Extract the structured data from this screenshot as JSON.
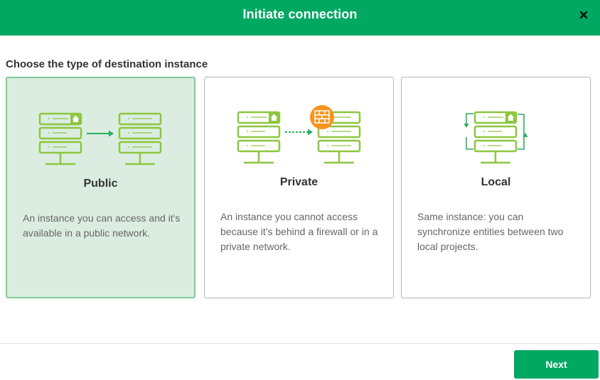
{
  "dialog": {
    "title": "Initiate connection",
    "close_icon": "close-icon"
  },
  "main": {
    "subtitle": "Choose the type of destination instance",
    "options": [
      {
        "title": "Public",
        "description": "An instance you can access and it's available in a public network.",
        "selected": true,
        "icon": "public-instance-icon"
      },
      {
        "title": "Private",
        "description": "An instance you cannot access because it's behind a firewall or in a private network.",
        "selected": false,
        "icon": "private-instance-icon"
      },
      {
        "title": "Local",
        "description": "Same instance: you can synchronize entities between two local projects.",
        "selected": false,
        "icon": "local-instance-icon"
      }
    ]
  },
  "footer": {
    "next_label": "Next"
  },
  "colors": {
    "brand_green": "#00a862",
    "icon_lime": "#8dc63f",
    "selected_bg": "#dbede1",
    "firewall_orange": "#f7941d"
  }
}
